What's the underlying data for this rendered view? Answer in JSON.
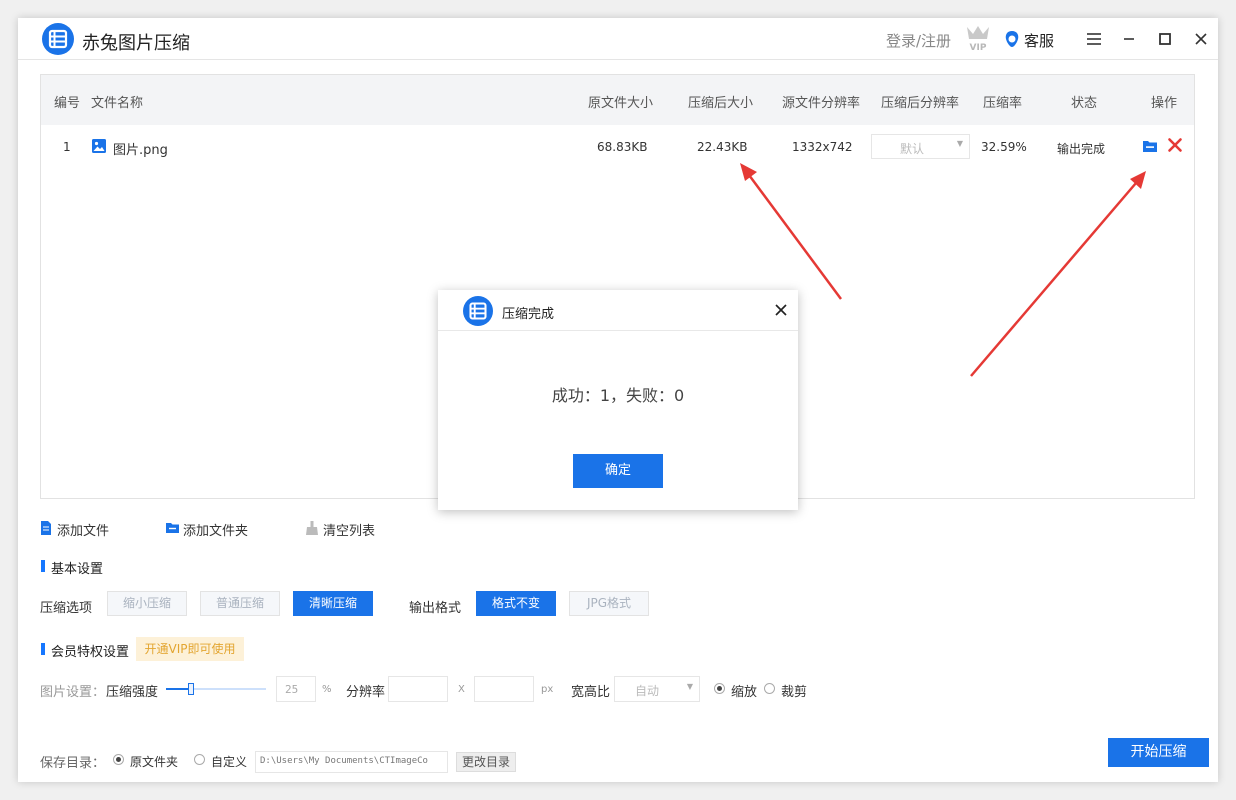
{
  "app": {
    "title": "赤兔图片压缩",
    "login_label": "登录/注册",
    "vip_icon": "vip-crown-icon",
    "service_label": "客服",
    "brand_color": "#1a73e8"
  },
  "table": {
    "headers": [
      "编号",
      "文件名称",
      "原文件大小",
      "压缩后大小",
      "源文件分辨率",
      "压缩后分辨率",
      "压缩率",
      "状态",
      "操作"
    ],
    "rows": [
      {
        "index": "1",
        "name": "图片.png",
        "orig_size": "68.83KB",
        "compressed_size": "22.43KB",
        "orig_resolution": "1332x742",
        "out_resolution": "默认",
        "ratio": "32.59%",
        "status": "输出完成"
      }
    ]
  },
  "actions": {
    "add_file": "添加文件",
    "add_folder": "添加文件夹",
    "clear_list": "清空列表"
  },
  "basic": {
    "section_title": "基本设置",
    "compress_label": "压缩选项",
    "compress_options": [
      "缩小压缩",
      "普通压缩",
      "清晰压缩"
    ],
    "compress_selected": "清晰压缩",
    "format_label": "输出格式",
    "format_options": [
      "格式不变",
      "JPG格式"
    ],
    "format_selected": "格式不变"
  },
  "vip": {
    "section_title": "会员特权设置",
    "badge": "开通VIP即可使用"
  },
  "image_settings": {
    "label": "图片设置：",
    "strength_label": "压缩强度",
    "strength_value": "25",
    "strength_unit": "%",
    "resolution_label": "分辨率",
    "x_label": "X",
    "px_label": "px",
    "aspect_label": "宽高比",
    "aspect_value": "自动",
    "scale_label": "缩放",
    "crop_label": "裁剪",
    "scale_selected": true
  },
  "save": {
    "label": "保存目录：",
    "option_original": "原文件夹",
    "option_custom": "自定义",
    "original_selected": true,
    "path": "D:\\Users\\My Documents\\CTImageCo",
    "change_label": "更改目录"
  },
  "start_label": "开始压缩",
  "dialog": {
    "title": "压缩完成",
    "message": "成功：1，失败：0",
    "ok_label": "确定"
  }
}
